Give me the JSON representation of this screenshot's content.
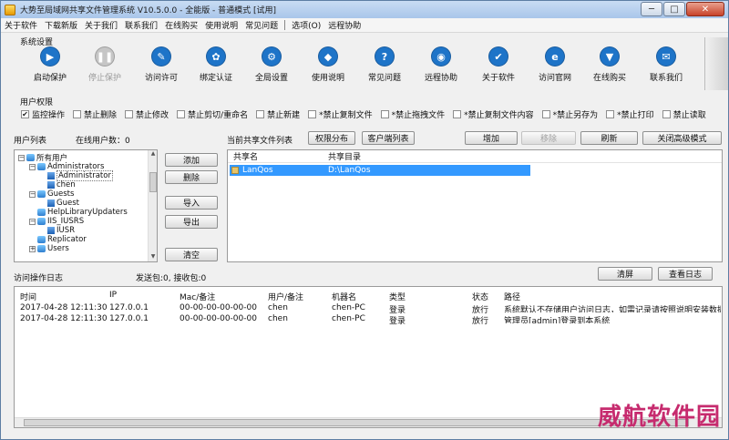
{
  "window": {
    "title": "大势至局域网共享文件管理系统 V10.5.0.0 - 全能版 - 普通模式 [试用]"
  },
  "window_buttons": {
    "minimize": "─",
    "maximize": "□",
    "close": "✕"
  },
  "menubar": [
    "关于软件",
    "下载新版",
    "关于我们",
    "联系我们",
    "在线购买",
    "使用说明",
    "常见问题",
    "选项(O)",
    "远程协助"
  ],
  "settings": {
    "group_label": "系统设置",
    "tools": [
      {
        "label": "启动保护",
        "icon": "play-icon",
        "glyph": "▶",
        "color": "#1e74c8",
        "disabled": false
      },
      {
        "label": "停止保护",
        "icon": "pause-icon",
        "glyph": "❚❚",
        "color": "#9a9a9a",
        "disabled": true
      },
      {
        "label": "访问许可",
        "icon": "key-icon",
        "glyph": "✎",
        "color": "#1e74c8",
        "disabled": false
      },
      {
        "label": "绑定认证",
        "icon": "gear-icon",
        "glyph": "✿",
        "color": "#1e74c8",
        "disabled": false
      },
      {
        "label": "全局设置",
        "icon": "settings-icon",
        "glyph": "⚙",
        "color": "#1e74c8",
        "disabled": false
      },
      {
        "label": "使用说明",
        "icon": "graduation-cap-icon",
        "glyph": "◆",
        "color": "#1e74c8",
        "disabled": false
      },
      {
        "label": "常见问题",
        "icon": "question-icon",
        "glyph": "?",
        "color": "#1e74c8",
        "disabled": false
      },
      {
        "label": "远程协助",
        "icon": "remote-icon",
        "glyph": "◉",
        "color": "#1e74c8",
        "disabled": false
      },
      {
        "label": "关于软件",
        "icon": "check-icon",
        "glyph": "✔",
        "color": "#1e74c8",
        "disabled": false
      },
      {
        "label": "访问官网",
        "icon": "ie-icon",
        "glyph": "e",
        "color": "#1e74c8",
        "disabled": false
      },
      {
        "label": "在线购买",
        "icon": "cart-icon",
        "glyph": "▼",
        "color": "#1e74c8",
        "disabled": false
      },
      {
        "label": "联系我们",
        "icon": "envelope-icon",
        "glyph": "✉",
        "color": "#1e74c8",
        "disabled": false
      }
    ]
  },
  "permissions": {
    "group_label": "用户权限",
    "items": [
      {
        "label": "监控操作",
        "checked": true
      },
      {
        "label": "禁止删除",
        "checked": false
      },
      {
        "label": "禁止修改",
        "checked": false
      },
      {
        "label": "禁止剪切/重命名",
        "checked": false
      },
      {
        "label": "禁止新建",
        "checked": false
      },
      {
        "label": "*禁止复制文件",
        "checked": false
      },
      {
        "label": "*禁止拖拽文件",
        "checked": false
      },
      {
        "label": "*禁止复制文件内容",
        "checked": false
      },
      {
        "label": "*禁止另存为",
        "checked": false
      },
      {
        "label": "*禁止打印",
        "checked": false
      },
      {
        "label": "禁止读取",
        "checked": false
      }
    ]
  },
  "users": {
    "list_label": "用户列表",
    "online_label": "在线用户数：0",
    "tree": [
      {
        "label": "所有用户",
        "type": "group",
        "expander": "−"
      },
      {
        "label": "Administrators",
        "type": "group",
        "expander": "−"
      },
      {
        "label": "Administrator",
        "type": "user",
        "selected": true
      },
      {
        "label": "chen",
        "type": "user"
      },
      {
        "label": "Guests",
        "type": "group",
        "expander": "−"
      },
      {
        "label": "Guest",
        "type": "user"
      },
      {
        "label": "HelpLibraryUpdaters",
        "type": "group",
        "expander": ""
      },
      {
        "label": "IIS_IUSRS",
        "type": "group",
        "expander": "−"
      },
      {
        "label": "IUSR",
        "type": "user"
      },
      {
        "label": "Replicator",
        "type": "group",
        "expander": ""
      },
      {
        "label": "Users",
        "type": "group",
        "expander": "+"
      }
    ],
    "buttons": {
      "add": "添加",
      "delete": "删除",
      "import": "导入",
      "export": "导出",
      "clear": "清空"
    }
  },
  "shares": {
    "label": "当前共享文件列表",
    "buttons": {
      "permission": "权限分布",
      "client_list": "客户端列表",
      "add": "增加",
      "remove": "移除",
      "refresh": "刷新",
      "advanced": "关闭高级模式"
    },
    "columns": [
      "共享名",
      "共享目录"
    ],
    "rows": [
      {
        "name": "LanQos",
        "path": "D:\\LanQos"
      }
    ]
  },
  "log": {
    "label": "访问操作日志",
    "packets": "发送包:0, 接收包:0",
    "buttons": {
      "clear": "清屏",
      "view": "查看日志"
    },
    "columns": [
      "时间",
      "IP",
      "Mac/备注",
      "用户/备注",
      "机器名",
      "类型",
      "状态",
      "路径"
    ],
    "rows": [
      [
        "2017-04-28 12:11:30",
        "127.0.0.1",
        "00-00-00-00-00-00",
        "chen",
        "chen-PC",
        "登录",
        "放行",
        "系统默认不存储用户访问日志，如需记录请按照说明安装数据库"
      ],
      [
        "2017-04-28 12:11:30",
        "127.0.0.1",
        "00-00-00-00-00-00",
        "chen",
        "chen-PC",
        "登录",
        "放行",
        "管理员[admin]登录到本系统"
      ]
    ]
  },
  "watermark": "威航软件园"
}
